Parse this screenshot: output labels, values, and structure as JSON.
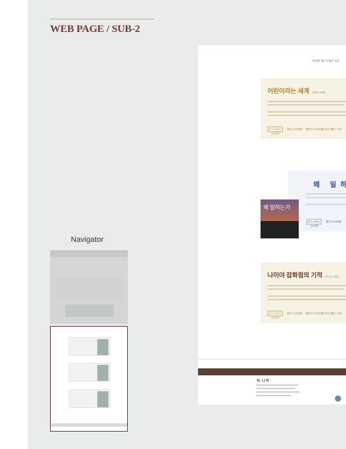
{
  "page_title": "WEB PAGE / SUB-2",
  "navigator": {
    "label": "Navigator"
  },
  "preview": {
    "tagline": "... 북세북 베스트셀러 모음",
    "books": [
      {
        "title": "어린이라는 세계",
        "author": "김소영 | 사계절",
        "button": "읽기 시작하기 도서구매",
        "price": "정가 15,000원 → 할인가 13,500원 (10% 할인 + 5%"
      },
      {
        "title": "왜 일하는가",
        "button": "읽기 시작하기 도서구매",
        "price": "정가 13,000원"
      },
      {
        "title": "나미야 잡화점의 기적",
        "author": "히가시노 게이고",
        "button": "읽기 시작하기 도서구매",
        "price": "정가 14,800원 → 할인가 13,320원 (10% 할인 + 5%"
      }
    ],
    "cover_text": "왜 일하는가",
    "footer_logo": "북·나북"
  }
}
